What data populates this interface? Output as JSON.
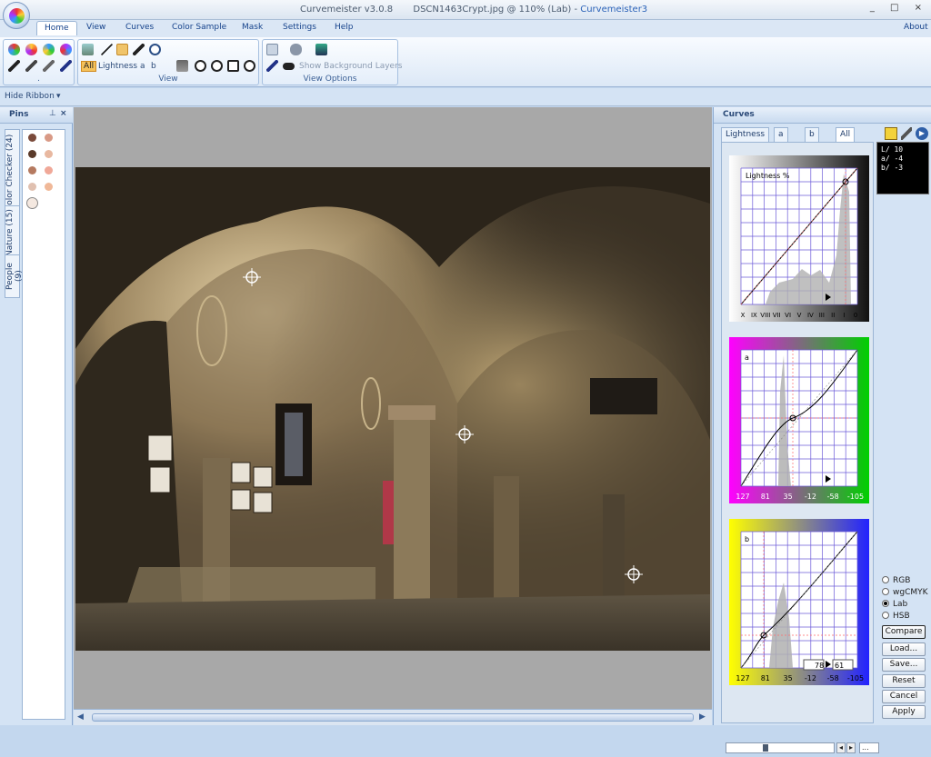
{
  "window": {
    "app_name": "Curvemeister v3.0.8",
    "document": "DSCN1463Crypt.jpg @ 110% (Lab)",
    "separator": "-",
    "brand": "Curvemeister3",
    "controls": "_ □ ×"
  },
  "tabs": [
    "Home",
    "View",
    "Curves",
    "Color Sample",
    "Mask",
    "Settings",
    "Help"
  ],
  "about_label": "About",
  "ribbon": {
    "group1_label": ".",
    "group2_label": "View",
    "group3_label": "View Options",
    "channel_all": "All",
    "channel_lightness": "Lightness",
    "channel_a": "a",
    "channel_b": "b",
    "show_background_layers": "Show Background Layers"
  },
  "hide_ribbon": "Hide Ribbon",
  "pins_panel": {
    "title": "Pins",
    "tabs": [
      "Color Checker (24)",
      "Nature (15)",
      "People (9)"
    ]
  },
  "curves_panel": {
    "title": "Curves",
    "tabs": [
      "Lightness",
      "a",
      "b",
      "All"
    ],
    "readout": [
      "L/ 10",
      "a/ -4",
      "b/ -3"
    ],
    "lightness": {
      "label": "Lightness %",
      "ticks": [
        "X",
        "IX",
        "VIII",
        "VII",
        "VI",
        "V",
        "IV",
        "III",
        "II",
        "I",
        "0"
      ]
    },
    "a": {
      "label": "a",
      "ticks": [
        "127",
        "81",
        "35",
        "-12",
        "-58",
        "-105"
      ]
    },
    "b": {
      "label": "b",
      "ticks": [
        "127",
        "81",
        "35",
        "-12",
        "-58",
        "-105"
      ],
      "input_in": "78",
      "input_out": "61"
    },
    "color_modes": [
      "RGB",
      "wgCMYK",
      "Lab",
      "HSB"
    ],
    "selected_mode": "Lab",
    "buttons": [
      "Compare",
      "Load...",
      "Save...",
      "Reset",
      "Cancel",
      "Apply"
    ],
    "slider_value": "..."
  },
  "colors": {
    "ribbon_text": "#15428b",
    "panel_bg": "#d4e3f4",
    "canvas_bg": "#a8a8a8",
    "grid": "#6d5bd9"
  }
}
